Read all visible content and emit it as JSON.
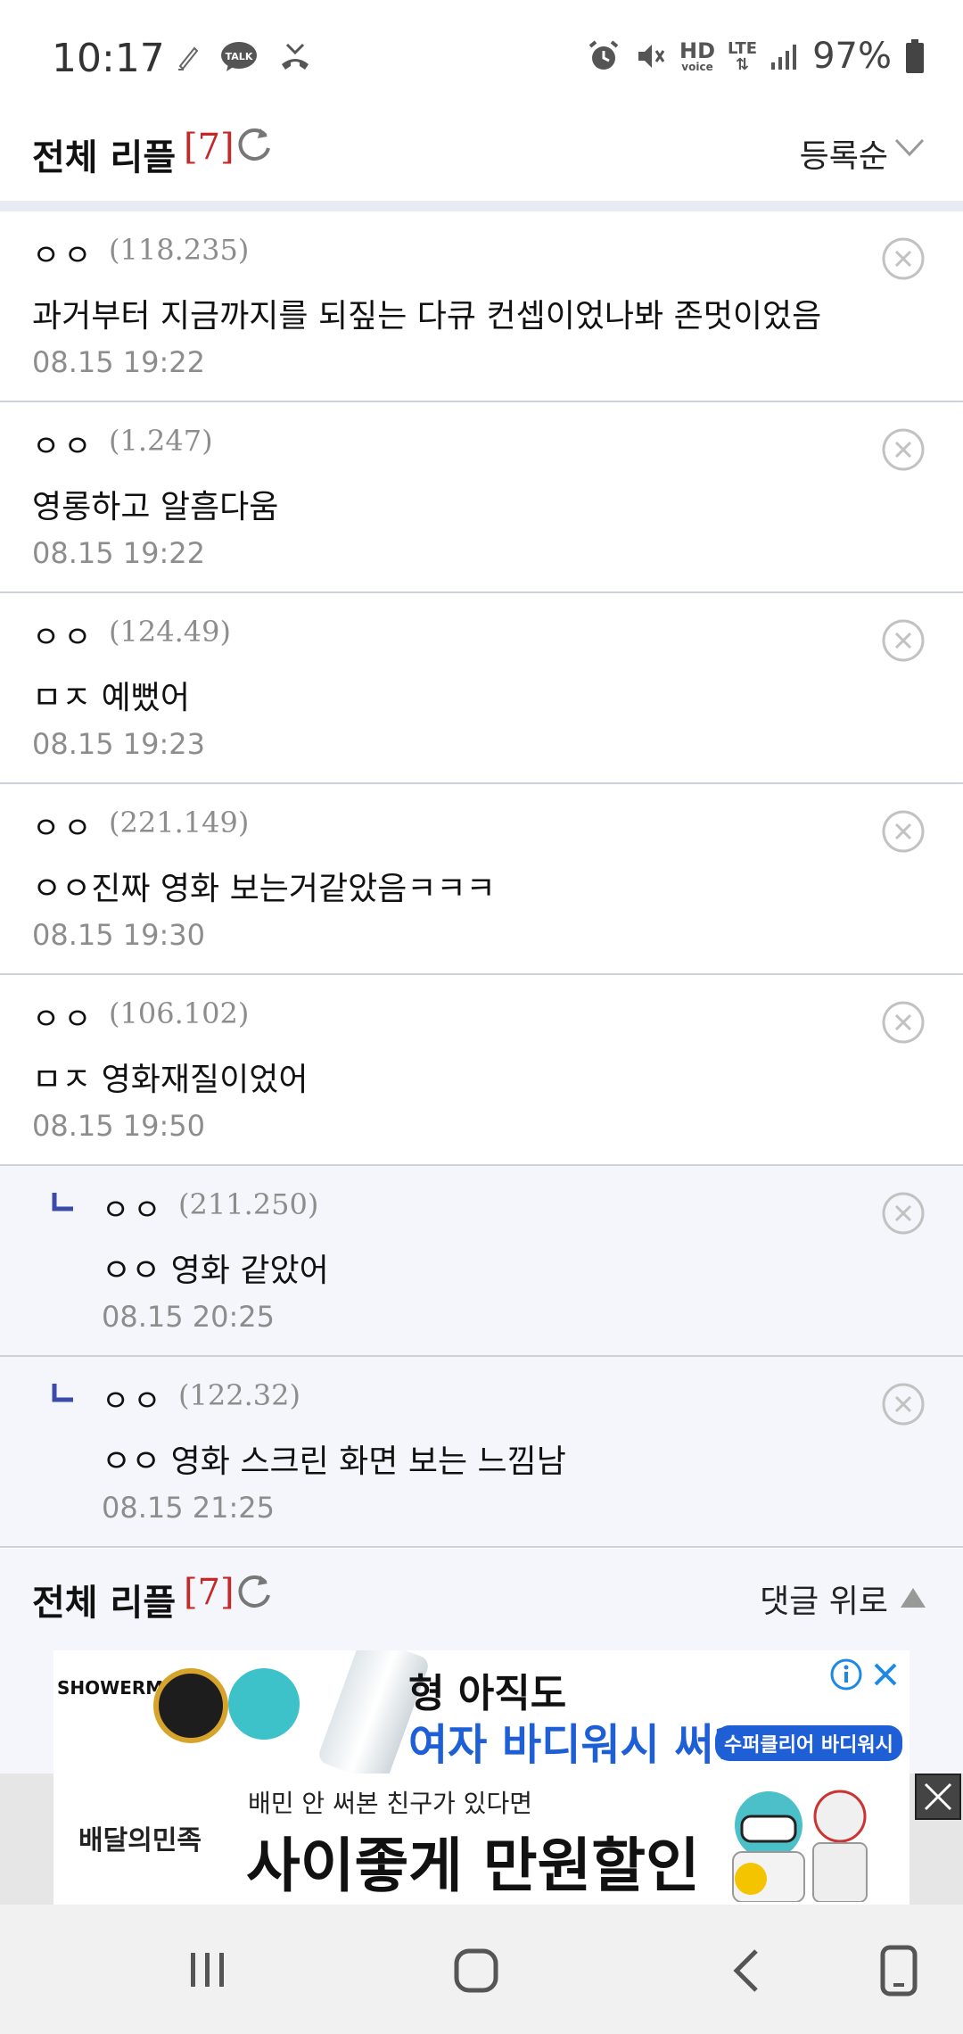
{
  "status_bar": {
    "time": "10:17",
    "talk_label": "TALK",
    "hd_label": "HD",
    "voice_label": "voice",
    "lte_label": "LTE",
    "battery": "97%",
    "icons": [
      "pen-icon",
      "talk-icon",
      "missed-call-icon",
      "alarm-icon",
      "mute-icon",
      "hd-voice-icon",
      "lte-icon",
      "signal-icon",
      "battery-icon"
    ]
  },
  "header": {
    "title": "전체 리플",
    "count": "[7]",
    "sort_label": "등록순"
  },
  "comments": [
    {
      "author": "ㅇㅇ",
      "ip": "(118.235)",
      "text": "과거부터 지금까지를 되짚는 다큐 컨셉이었나봐 존멋이었음",
      "date": "08.15 19:22",
      "reply": false
    },
    {
      "author": "ㅇㅇ",
      "ip": "(1.247)",
      "text": "영롱하고 알흠다움",
      "date": "08.15 19:22",
      "reply": false
    },
    {
      "author": "ㅇㅇ",
      "ip": "(124.49)",
      "text": "ㅁㅈ 예뻤어",
      "date": "08.15 19:23",
      "reply": false
    },
    {
      "author": "ㅇㅇ",
      "ip": "(221.149)",
      "text": "ㅇㅇ진짜 영화 보는거같았음ㅋㅋㅋ",
      "date": "08.15 19:30",
      "reply": false
    },
    {
      "author": "ㅇㅇ",
      "ip": "(106.102)",
      "text": "ㅁㅈ 영화재질이었어",
      "date": "08.15 19:50",
      "reply": false
    },
    {
      "author": "ㅇㅇ",
      "ip": "(211.250)",
      "text": "ㅇㅇ 영화 같았어",
      "date": "08.15 20:25",
      "reply": true
    },
    {
      "author": "ㅇㅇ",
      "ip": "(122.32)",
      "text": "ㅇㅇ 영화 스크린 화면 보는 느낌남",
      "date": "08.15 21:25",
      "reply": true
    }
  ],
  "bottom_bar": {
    "title": "전체 리플",
    "count": "[7]",
    "scroll_up_label": "댓글 위로"
  },
  "ads": {
    "ad1_logo": "SHOWERMATE",
    "ad1_line1": "형 아직도",
    "ad1_line2": "여자 바디워시 써?",
    "ad1_pill": "수퍼클리어 바디워시",
    "ad2_brand": "배달의민족",
    "ad2_sub": "배민 안 써본 친구가 있다면",
    "ad2_main": "사이좋게 만원할인"
  },
  "colors": {
    "accent_red": "#c62828",
    "divider": "#cdd1dd",
    "reply_bg": "#f4f6fb",
    "ad_blue": "#1f5fd6"
  }
}
